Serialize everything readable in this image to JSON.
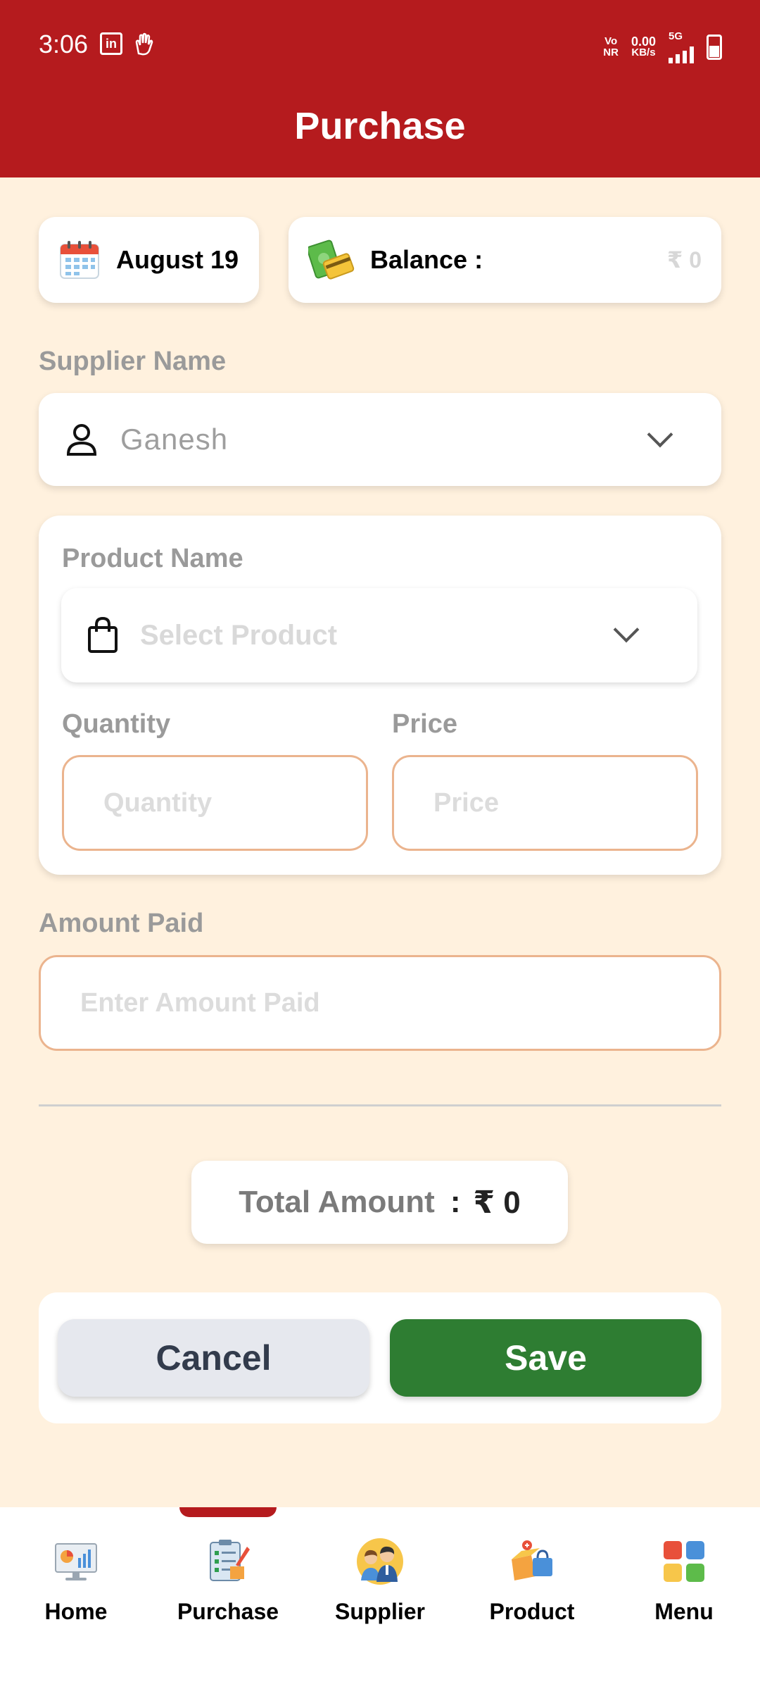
{
  "status_bar": {
    "time": "3:06",
    "left_icons": [
      "linkedin-icon",
      "hand-icon"
    ],
    "volte_top": "Vo",
    "volte_bottom": "NR",
    "speed_value": "0.00",
    "speed_unit": "KB/s",
    "network": "5G"
  },
  "header": {
    "title": "Purchase"
  },
  "date_card": {
    "label": "August 19"
  },
  "balance_card": {
    "label": "Balance :",
    "value": "₹ 0"
  },
  "supplier": {
    "label": "Supplier Name",
    "selected": "Ganesh"
  },
  "product": {
    "label": "Product Name",
    "placeholder": "Select Product",
    "quantity_label": "Quantity",
    "quantity_placeholder": "Quantity",
    "price_label": "Price",
    "price_placeholder": "Price"
  },
  "amount_paid": {
    "label": "Amount Paid",
    "placeholder": "Enter Amount Paid"
  },
  "total": {
    "label": "Total Amount",
    "colon": ":",
    "value": "₹ 0"
  },
  "actions": {
    "cancel": "Cancel",
    "save": "Save"
  },
  "nav": {
    "active": "Purchase",
    "items": [
      {
        "label": "Home",
        "icon": "dashboard-icon"
      },
      {
        "label": "Purchase",
        "icon": "clipboard-icon"
      },
      {
        "label": "Supplier",
        "icon": "people-icon"
      },
      {
        "label": "Product",
        "icon": "box-icon"
      },
      {
        "label": "Menu",
        "icon": "grid-icon"
      }
    ]
  },
  "colors": {
    "brand": "#B51B1E",
    "background": "#FFF1DE",
    "save": "#2E7D32",
    "cancel": "#E6E8EE",
    "input_border": "#EBB48E"
  }
}
